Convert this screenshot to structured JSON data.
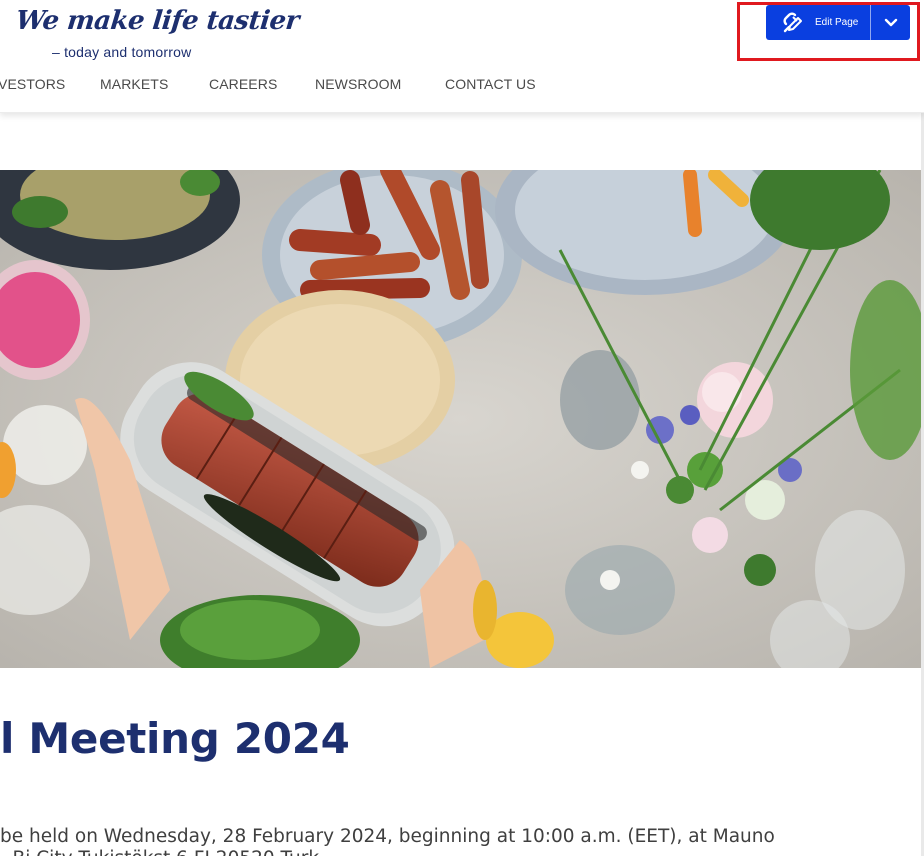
{
  "brand": {
    "tagline": "We make life tastier",
    "subtagline": "– today and tomorrow"
  },
  "nav": {
    "items": [
      {
        "label": "VESTORS"
      },
      {
        "label": "MARKETS"
      },
      {
        "label": "CAREERS"
      },
      {
        "label": "NEWSROOM"
      },
      {
        "label": "CONTACT US"
      }
    ]
  },
  "editor": {
    "edit_label": "Edit Page",
    "edit_icon": "link-pencil-icon",
    "dropdown_icon": "chevron-down-icon",
    "accent": "#0a3fe0",
    "highlight_color": "#e0191f"
  },
  "hero": {
    "alt": "Food table with sliced roast, sausages, salad and flowers",
    "dominant_colors": [
      "#c9c6c0",
      "#8a3a22",
      "#3e6a2a",
      "#e8a53a"
    ]
  },
  "article": {
    "title": "l Meeting 2024",
    "line1": "be held on Wednesday, 28 February 2024, beginning at 10:00 a.m. (EET), at Mauno",
    "line2": "- Bi  City  Tukistökst  6  FI 20520 Turk"
  },
  "colors": {
    "brand_navy": "#1d2f6f",
    "nav_text": "#4a4a4a",
    "body_text": "#3f3f3f"
  }
}
